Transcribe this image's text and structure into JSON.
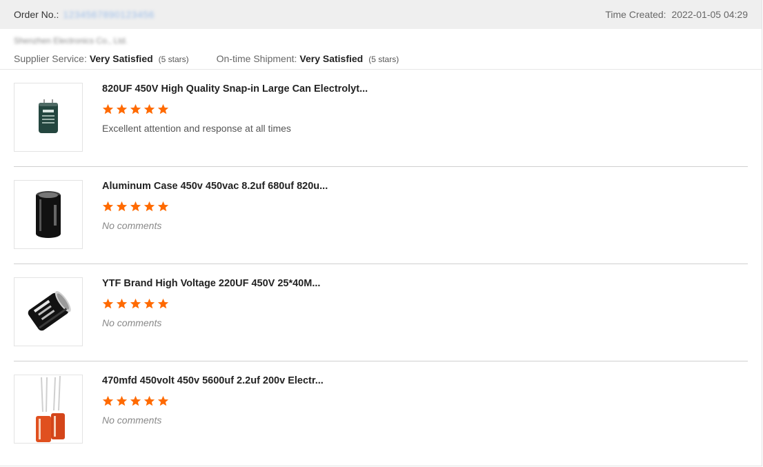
{
  "header": {
    "order_label": "Order No.:",
    "order_number": "1234567890123456",
    "time_label": "Time Created:",
    "time_value": "2022-01-05 04:29"
  },
  "supplier": {
    "name": "Shenzhen Electronics Co., Ltd.",
    "service_label": "Supplier Service:",
    "service_value": "Very Satisfied",
    "service_stars": "(5 stars)",
    "shipment_label": "On-time Shipment:",
    "shipment_value": "Very Satisfied",
    "shipment_stars": "(5 stars)"
  },
  "colors": {
    "star": "#ff6a00",
    "accent_link": "#9bbde9"
  },
  "items": [
    {
      "title": "820UF 450V High Quality Snap-in Large Can Electrolyt...",
      "rating": 5,
      "comment": "Excellent attention and response at all times",
      "has_comment": true,
      "image_icon": "capacitor-dark-icon"
    },
    {
      "title": "Aluminum Case 450v 450vac 8.2uf 680uf 820u...",
      "rating": 5,
      "comment": "No comments",
      "has_comment": false,
      "image_icon": "capacitor-black-icon"
    },
    {
      "title": "YTF Brand High Voltage 220UF 450V 25*40M...",
      "rating": 5,
      "comment": "No comments",
      "has_comment": false,
      "image_icon": "capacitor-tilted-icon"
    },
    {
      "title": "470mfd 450volt 450v 5600uf 2.2uf 200v Electr...",
      "rating": 5,
      "comment": "No comments",
      "has_comment": false,
      "image_icon": "capacitor-orange-icon"
    }
  ]
}
